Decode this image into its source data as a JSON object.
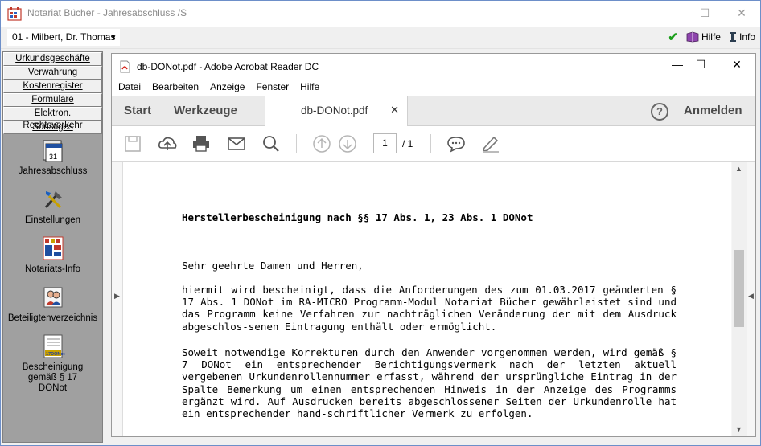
{
  "window": {
    "title": "Notariat Bücher - Jahresabschluss /S",
    "minimize": "—",
    "maximize": "☐",
    "close": "✕"
  },
  "toolbar": {
    "user_value": "01 - Milbert, Dr. Thomas",
    "help_label": "Hilfe",
    "info_label": "Info"
  },
  "leftnav": {
    "buttons": [
      "Urkundsgeschäfte",
      "Verwahrung",
      "Kostenregister",
      "Formulare",
      "Elektron. Rechtsverkehr",
      "Sonstiges"
    ],
    "items": [
      {
        "label": "Jahresabschluss",
        "icon": "calendar-icon"
      },
      {
        "label": "Einstellungen",
        "icon": "tools-icon"
      },
      {
        "label": "Notariats-Info",
        "icon": "building-icon"
      },
      {
        "label": "Beteiligtenverzeichnis",
        "icon": "people-icon"
      },
      {
        "label": "Bescheinigung gemäß § 17 DONot",
        "icon": "certificate-icon",
        "badge": "17DONot"
      }
    ]
  },
  "acrobat": {
    "title": "db-DONot.pdf - Adobe Acrobat Reader DC",
    "menu": [
      "Datei",
      "Bearbeiten",
      "Anzeige",
      "Fenster",
      "Hilfe"
    ],
    "tabs": {
      "start": "Start",
      "tools": "Werkzeuge",
      "doc": "db-DONot.pdf",
      "close": "✕",
      "help": "?",
      "signin": "Anmelden"
    },
    "page_current": "1",
    "page_total": "/ 1"
  },
  "document": {
    "heading": "Herstellerbescheinigung nach §§ 17 Abs. 1, 23 Abs. 1 DONot",
    "salutation": "Sehr geehrte Damen und Herren,",
    "para1": "hiermit wird bescheinigt, dass die Anforderungen des zum 01.03.2017 geänderten § 17 Abs. 1 DONot im RA-MICRO Programm-Modul Notariat Bücher gewährleistet sind und das Programm keine Verfahren zur nachträglichen Veränderung der mit dem Ausdruck abgeschlos-senen Eintragung enthält oder ermöglicht.",
    "para2": "Soweit notwendige Korrekturen durch den Anwender vorgenommen werden, wird gemäß § 7 DONot ein entsprechender Berichtigungsvermerk nach der letzten aktuell vergebenen Urkundenrollennummer erfasst, während der ursprüngliche Eintrag in der Spalte Bemerkung um einen entsprechenden Hinweis in der Anzeige des Programms ergänzt wird. Auf Ausdrucken bereits abgeschlossener Seiten der Urkundenrolle hat ein entsprechender hand-schriftlicher Vermerk zu erfolgen."
  },
  "colors": {
    "check": "#1a9e1a",
    "acrobat_red": "#d4251c"
  }
}
